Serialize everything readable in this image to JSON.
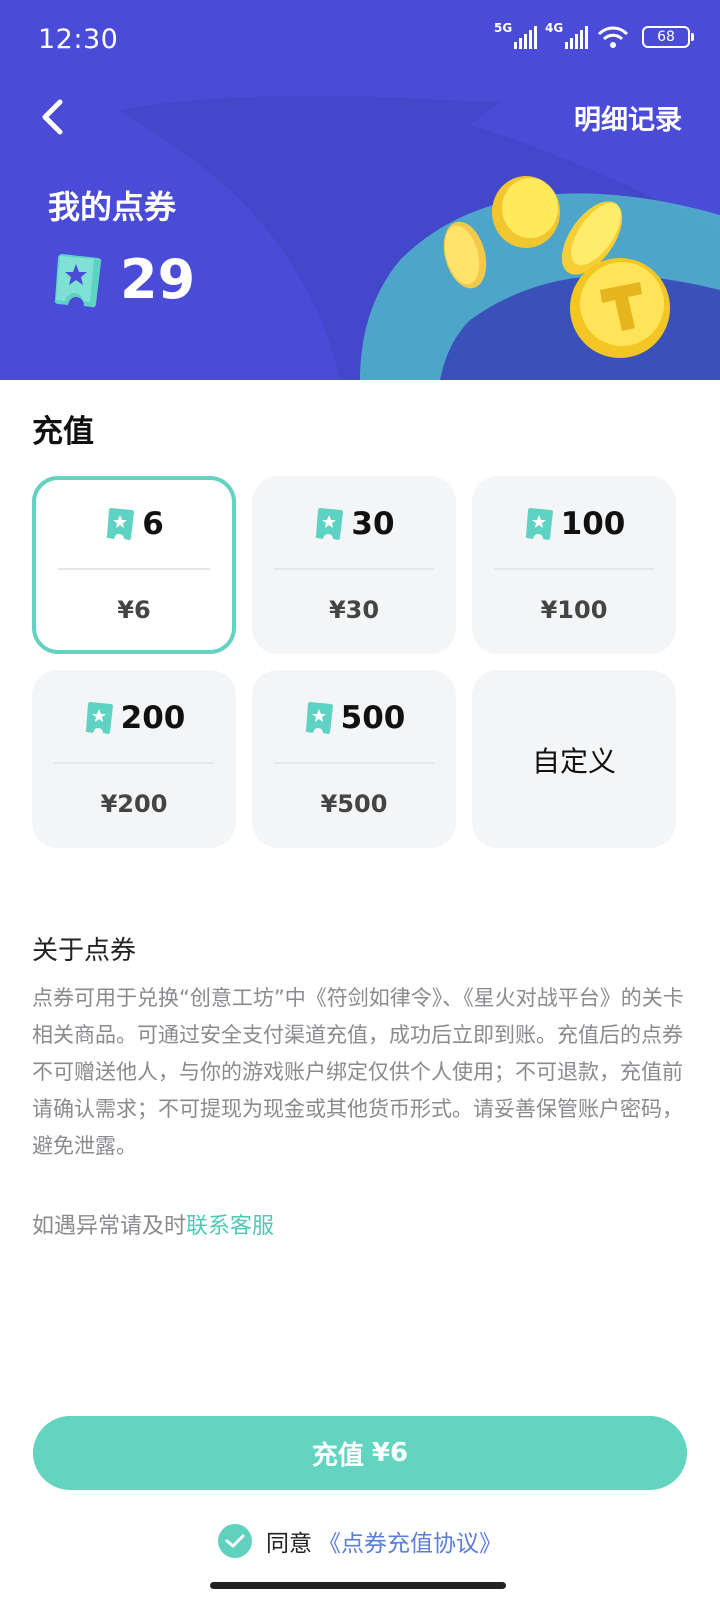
{
  "status_bar": {
    "time": "12:30",
    "net1": "5G",
    "net2": "4G",
    "battery": "68",
    "icons": [
      "signal-5g-icon",
      "signal-4g-icon",
      "wifi-icon",
      "battery-icon"
    ]
  },
  "header": {
    "back_icon": "chevron-left-icon",
    "details_label": "明细记录",
    "title": "我的点券",
    "balance": "29",
    "ticket_icon": "ticket-star-icon"
  },
  "recharge": {
    "title": "充值",
    "options": [
      {
        "amount": "6",
        "price": "¥6",
        "selected": true
      },
      {
        "amount": "30",
        "price": "¥30",
        "selected": false
      },
      {
        "amount": "100",
        "price": "¥100",
        "selected": false
      },
      {
        "amount": "200",
        "price": "¥200",
        "selected": false
      },
      {
        "amount": "500",
        "price": "¥500",
        "selected": false
      }
    ],
    "custom_label": "自定义"
  },
  "about": {
    "title": "关于点券",
    "text": "点券可用于兑换“创意工坊”中《符剑如律令》、《星火对战平台》的关卡相关商品。可通过安全支付渠道充值，成功后立即到账。充值后的点券不可赠送他人，与你的游戏账户绑定仅供个人使用；不可退款，充值前请确认需求；不可提现为现金或其他货币形式。请妥善保管账户密码，避免泄露。",
    "contact_prefix": "如遇异常请及时",
    "contact_link": "联系客服"
  },
  "footer": {
    "pay_label": "充值",
    "pay_amount": "¥6",
    "agree_label": "同意",
    "agreement_link": "《点券充值协议》"
  },
  "colors": {
    "header_bg": "#4a4bd6",
    "accent": "#63d4c0",
    "link_blue": "#5a7fd8",
    "card_bg": "#f4f5f7"
  }
}
